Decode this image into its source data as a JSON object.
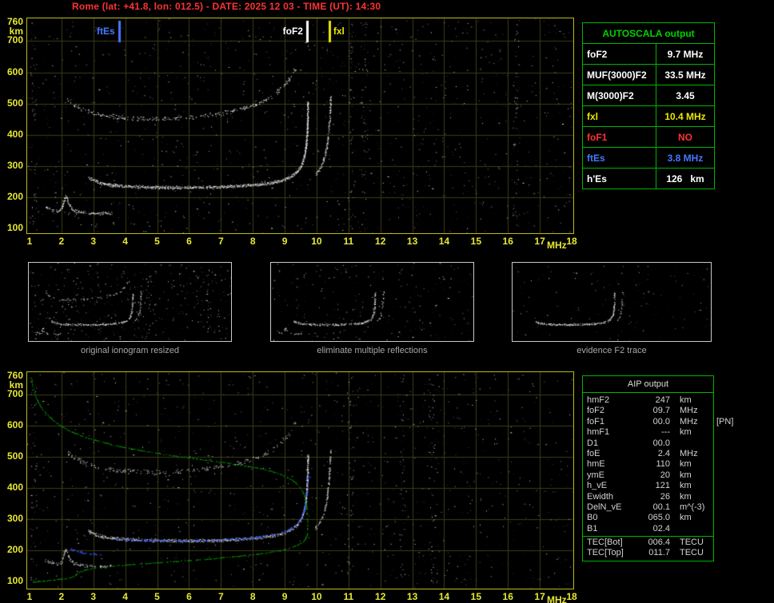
{
  "title": "Rome (lat: +41.8, lon: 012.5) - DATE: 2025 12 03 - TIME (UT): 14:30",
  "colors": {
    "background": "#000000",
    "axis_yellow": "#e8e832",
    "plot_border": "#b9b920",
    "grid": "#3a3a16",
    "title_red": "#ff3232",
    "table_green": "#00b400",
    "header_green": "#00d200",
    "trace_white": "#ffffff",
    "fxl_yellow": "#e8e800",
    "fof1_red": "#ff3232",
    "ftes_blue": "#4678ff",
    "profile_green": "#00c800",
    "restored_blue": "#2d55ff",
    "caption_gray": "#a8a8a8",
    "aip_text": "#d2d2d2"
  },
  "autoscala_table": {
    "header": "AUTOSCALA output",
    "rows": [
      {
        "label": "foF2",
        "value": "9.7 MHz",
        "color": "#ffffff"
      },
      {
        "label": "MUF(3000)F2",
        "value": "33.5 MHz",
        "color": "#ffffff"
      },
      {
        "label": "M(3000)F2",
        "value": "3.45",
        "color": "#ffffff"
      },
      {
        "label": "fxl",
        "value": "10.4 MHz",
        "color": "#e8e800"
      },
      {
        "label": "foF1",
        "value": "NO",
        "color": "#ff3232"
      },
      {
        "label": "ftEs",
        "value": "3.8 MHz",
        "color": "#4678ff"
      },
      {
        "label": "h'Es",
        "value": "126   km",
        "color": "#ffffff"
      }
    ]
  },
  "aip_table": {
    "header": "AIP output",
    "rows": [
      {
        "name": "hmF2",
        "value": "247",
        "unit": "km",
        "extra": ""
      },
      {
        "name": "foF2",
        "value": "09.7",
        "unit": "MHz",
        "extra": ""
      },
      {
        "name": "foF1",
        "value": "00.0",
        "unit": "MHz",
        "extra": "[PN]"
      },
      {
        "name": "hmF1",
        "value": "---",
        "unit": "km",
        "extra": ""
      },
      {
        "name": "D1",
        "value": "00.0",
        "unit": "",
        "extra": ""
      },
      {
        "name": "foE",
        "value": "2.4",
        "unit": "MHz",
        "extra": ""
      },
      {
        "name": "hmE",
        "value": "110",
        "unit": "km",
        "extra": ""
      },
      {
        "name": "ymE",
        "value": "20",
        "unit": "km",
        "extra": ""
      },
      {
        "name": "h_vE",
        "value": "121",
        "unit": "km",
        "extra": ""
      },
      {
        "name": "Ewidth",
        "value": "26",
        "unit": "km",
        "extra": ""
      },
      {
        "name": "DelN_vE",
        "value": "00.1",
        "unit": "m^(-3)",
        "extra": ""
      },
      {
        "name": "B0",
        "value": "065.0",
        "unit": "km",
        "extra": ""
      },
      {
        "name": "B1",
        "value": "02.4",
        "unit": "",
        "extra": ""
      }
    ],
    "tec_rows": [
      {
        "name": "TEC[Bot]",
        "value": "006.4",
        "unit": "TECU",
        "extra": ""
      },
      {
        "name": "TEC[Top]",
        "value": "011.7",
        "unit": "TECU",
        "extra": ""
      }
    ]
  },
  "thumbnails": [
    {
      "caption": "original ionogram resized"
    },
    {
      "caption": "eliminate multiple reflections"
    },
    {
      "caption": "evidence F2 trace"
    }
  ],
  "chart_data": [
    {
      "id": "top_ionogram",
      "type": "scatter",
      "title": "",
      "xlabel": "MHz",
      "ylabel": "km",
      "xlim": [
        1,
        18
      ],
      "ylim": [
        100,
        760
      ],
      "x_ticks": [
        1,
        2,
        3,
        4,
        5,
        6,
        7,
        8,
        9,
        10,
        11,
        12,
        13,
        14,
        15,
        16,
        17,
        18
      ],
      "y_ticks": [
        760,
        700,
        600,
        500,
        400,
        300,
        200,
        100
      ],
      "grid": true,
      "markers": [
        {
          "label": "ftEs",
          "x": 3.8,
          "color": "#4678ff",
          "label_side": "left"
        },
        {
          "label": "foF2",
          "x": 9.7,
          "color": "#ffffff",
          "label_side": "left"
        },
        {
          "label": "fxl",
          "x": 10.4,
          "color": "#e8e800",
          "label_side": "right"
        }
      ],
      "noise_columns": [
        1.12,
        11.1,
        11.5,
        16.25
      ],
      "series": [
        {
          "name": "E-Es trace",
          "color": "#ffffff",
          "points": [
            [
              1.5,
              168
            ],
            [
              1.7,
              160
            ],
            [
              1.9,
              157
            ],
            [
              2.0,
              165
            ],
            [
              2.07,
              190
            ],
            [
              2.12,
              202
            ],
            [
              2.2,
              185
            ],
            [
              2.3,
              166
            ],
            [
              2.45,
              157
            ],
            [
              2.7,
              152
            ],
            [
              3.0,
              150
            ],
            [
              3.3,
              149
            ],
            [
              3.55,
              150
            ]
          ]
        },
        {
          "name": "F trace o-mode (foF2 9.7 MHz)",
          "color": "#ffffff",
          "points": [
            [
              2.85,
              262
            ],
            [
              3.1,
              250
            ],
            [
              3.5,
              241
            ],
            [
              4.0,
              236
            ],
            [
              4.8,
              233
            ],
            [
              5.8,
              232
            ],
            [
              6.8,
              233
            ],
            [
              7.6,
              237
            ],
            [
              8.3,
              243
            ],
            [
              8.8,
              252
            ],
            [
              9.15,
              265
            ],
            [
              9.4,
              285
            ],
            [
              9.55,
              312
            ],
            [
              9.64,
              350
            ],
            [
              9.69,
              400
            ],
            [
              9.71,
              450
            ],
            [
              9.72,
              505
            ]
          ]
        },
        {
          "name": "F trace x-mode (fxl 10.4 MHz)",
          "color": "#ffffff",
          "points": [
            [
              9.95,
              272
            ],
            [
              10.1,
              292
            ],
            [
              10.22,
              322
            ],
            [
              10.31,
              362
            ],
            [
              10.37,
              412
            ],
            [
              10.41,
              468
            ],
            [
              10.43,
              520
            ]
          ]
        },
        {
          "name": "F second-hop reflection",
          "color": "#ffffff",
          "points": [
            [
              2.2,
              512
            ],
            [
              2.5,
              492
            ],
            [
              2.9,
              474
            ],
            [
              3.4,
              462
            ],
            [
              4.1,
              455
            ],
            [
              4.9,
              452
            ],
            [
              5.8,
              456
            ],
            [
              6.6,
              464
            ],
            [
              7.3,
              476
            ],
            [
              7.9,
              492
            ],
            [
              8.45,
              515
            ],
            [
              8.85,
              545
            ],
            [
              9.15,
              580
            ],
            [
              9.35,
              615
            ]
          ]
        }
      ]
    },
    {
      "id": "bottom_ionogram_with_profile",
      "type": "scatter",
      "title": "",
      "xlabel": "MHz",
      "ylabel": "km",
      "xlim": [
        1,
        18
      ],
      "ylim": [
        100,
        760
      ],
      "x_ticks": [
        1,
        2,
        3,
        4,
        5,
        6,
        7,
        8,
        9,
        10,
        11,
        12,
        13,
        14,
        15,
        16,
        17,
        18
      ],
      "y_ticks": [
        760,
        700,
        600,
        500,
        400,
        300,
        200,
        100
      ],
      "grid": true,
      "markers": [],
      "noise_columns": [
        1.12,
        11.05,
        12.7,
        13.6
      ],
      "series": [
        {
          "name": "E-Es trace",
          "color": "#ffffff",
          "points": [
            [
              1.5,
              168
            ],
            [
              1.7,
              160
            ],
            [
              1.9,
              157
            ],
            [
              2.0,
              165
            ],
            [
              2.07,
              190
            ],
            [
              2.12,
              202
            ],
            [
              2.2,
              185
            ],
            [
              2.3,
              166
            ],
            [
              2.45,
              157
            ],
            [
              2.7,
              152
            ],
            [
              3.0,
              150
            ],
            [
              3.3,
              149
            ],
            [
              3.55,
              150
            ]
          ]
        },
        {
          "name": "F trace o-mode",
          "color": "#ffffff",
          "points": [
            [
              2.85,
              262
            ],
            [
              3.1,
              250
            ],
            [
              3.5,
              241
            ],
            [
              4.0,
              236
            ],
            [
              4.8,
              233
            ],
            [
              5.8,
              232
            ],
            [
              6.8,
              233
            ],
            [
              7.6,
              237
            ],
            [
              8.3,
              243
            ],
            [
              8.8,
              252
            ],
            [
              9.15,
              265
            ],
            [
              9.4,
              285
            ],
            [
              9.55,
              312
            ],
            [
              9.64,
              350
            ],
            [
              9.69,
              400
            ],
            [
              9.71,
              450
            ],
            [
              9.72,
              505
            ]
          ]
        },
        {
          "name": "F trace x-mode",
          "color": "#ffffff",
          "points": [
            [
              9.95,
              272
            ],
            [
              10.1,
              292
            ],
            [
              10.22,
              322
            ],
            [
              10.31,
              362
            ],
            [
              10.37,
              412
            ],
            [
              10.41,
              468
            ],
            [
              10.43,
              520
            ]
          ]
        },
        {
          "name": "F second-hop reflection",
          "color": "#ffffff",
          "points": [
            [
              2.2,
              512
            ],
            [
              2.5,
              492
            ],
            [
              2.9,
              474
            ],
            [
              3.4,
              462
            ],
            [
              4.1,
              455
            ],
            [
              4.9,
              452
            ],
            [
              5.8,
              456
            ],
            [
              6.6,
              464
            ],
            [
              7.3,
              476
            ],
            [
              7.9,
              492
            ],
            [
              8.45,
              515
            ],
            [
              8.85,
              545
            ],
            [
              9.15,
              580
            ],
            [
              9.35,
              615
            ]
          ]
        }
      ],
      "profile": {
        "name": "AIP electron density profile (hmF2 247 km)",
        "color": "#00c800",
        "points": [
          [
            1.05,
            752
          ],
          [
            1.15,
            705
          ],
          [
            1.35,
            662
          ],
          [
            1.7,
            622
          ],
          [
            2.2,
            588
          ],
          [
            2.9,
            560
          ],
          [
            3.8,
            536
          ],
          [
            4.9,
            515
          ],
          [
            6.1,
            497
          ],
          [
            7.3,
            480
          ],
          [
            8.4,
            460
          ],
          [
            9.15,
            432
          ],
          [
            9.5,
            398
          ],
          [
            9.65,
            360
          ],
          [
            9.7,
            310
          ],
          [
            9.7,
            265
          ],
          [
            9.68,
            247
          ],
          [
            9.5,
            224
          ],
          [
            9.0,
            204
          ],
          [
            8.2,
            190
          ],
          [
            7.1,
            178
          ],
          [
            5.9,
            168
          ],
          [
            4.7,
            159
          ],
          [
            3.7,
            151
          ],
          [
            3.0,
            143
          ],
          [
            2.6,
            133
          ],
          [
            2.45,
            124
          ],
          [
            2.4,
            118
          ],
          [
            2.2,
            112
          ],
          [
            1.9,
            108
          ],
          [
            1.55,
            104
          ],
          [
            1.25,
            101
          ],
          [
            1.1,
            98
          ]
        ]
      },
      "restored": {
        "name": "AUTOSCALA restored trace",
        "color": "#2d55ff",
        "segments": [
          [
            [
              2.3,
              205
            ],
            [
              2.6,
              196
            ],
            [
              2.95,
              190
            ],
            [
              3.2,
              188
            ]
          ],
          [
            [
              3.6,
              240
            ],
            [
              4.2,
              235
            ],
            [
              5.0,
              233
            ],
            [
              6.0,
              233
            ],
            [
              7.0,
              236
            ],
            [
              7.8,
              241
            ],
            [
              8.4,
              249
            ],
            [
              8.9,
              260
            ],
            [
              9.25,
              278
            ],
            [
              9.5,
              305
            ],
            [
              9.62,
              345
            ],
            [
              9.68,
              395
            ],
            [
              9.71,
              448
            ]
          ]
        ]
      }
    }
  ]
}
